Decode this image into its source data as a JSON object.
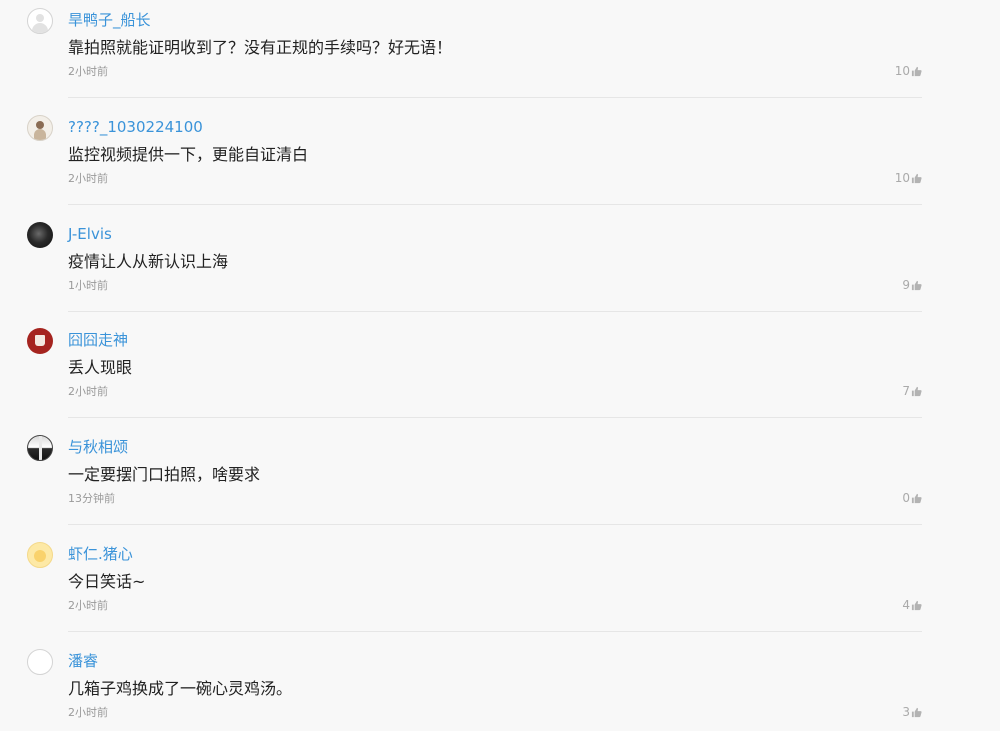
{
  "comments": [
    {
      "username": "旱鸭子_船长",
      "content": "靠拍照就能证明收到了？没有正规的手续吗？好无语！",
      "time": "2小时前",
      "likes": "10",
      "avatar": "default-avatar"
    },
    {
      "username": "????_1030224100",
      "content": "监控视频提供一下，更能自证清白",
      "time": "2小时前",
      "likes": "10",
      "avatar": "photo-avatar"
    },
    {
      "username": "J-Elvis",
      "content": "疫情让人从新认识上海",
      "time": "1小时前",
      "likes": "9",
      "avatar": "dark-avatar"
    },
    {
      "username": "囧囧走神",
      "content": "丢人现眼",
      "time": "2小时前",
      "likes": "7",
      "avatar": "red-avatar"
    },
    {
      "username": "与秋相颂",
      "content": "一定要摆门口拍照，啥要求",
      "time": "13分钟前",
      "likes": "0",
      "avatar": "split-avatar"
    },
    {
      "username": "虾仁.猪心",
      "content": "今日笑话~",
      "time": "2小时前",
      "likes": "4",
      "avatar": "yellow-avatar"
    },
    {
      "username": "潘睿",
      "content": "几箱子鸡换成了一碗心灵鸡汤。",
      "time": "2小时前",
      "likes": "3",
      "avatar": "default-avatar"
    }
  ],
  "colors": {
    "username": "#3a93d9",
    "content": "#222222",
    "meta": "#9a9a9a",
    "divider": "#e6e6e6",
    "background": "#f8f8f8"
  },
  "icons": {
    "like": "thumbs-up-icon"
  }
}
